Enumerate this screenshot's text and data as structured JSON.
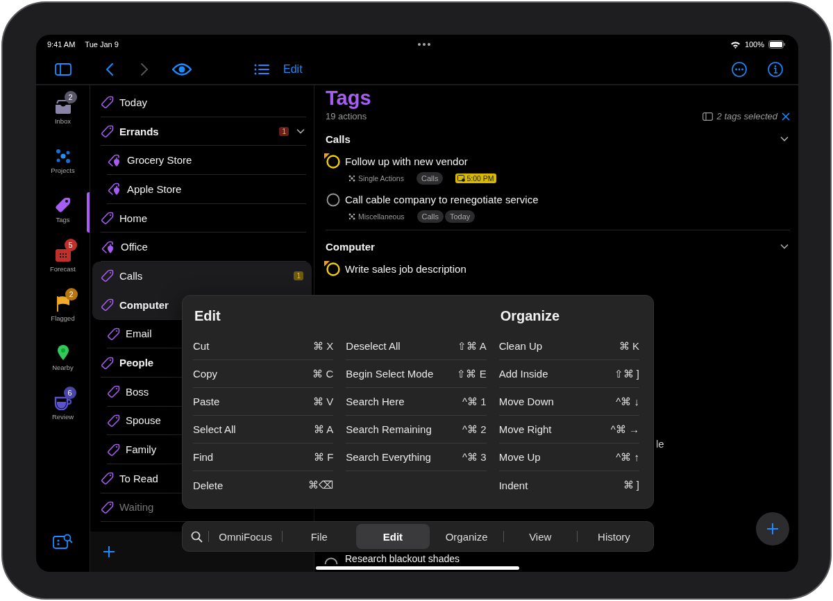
{
  "status_bar": {
    "time": "9:41 AM",
    "date": "Tue Jan 9",
    "battery": "100%"
  },
  "toolbar": {
    "edit_label": "Edit"
  },
  "rail": [
    {
      "kind": "inbox",
      "label": "Inbox",
      "badge": "2",
      "color": "#5a5868",
      "selected": false
    },
    {
      "kind": "projects",
      "label": "Projects",
      "selected": false
    },
    {
      "kind": "tags",
      "label": "Tags",
      "selected": true
    },
    {
      "kind": "forecast",
      "label": "Forecast",
      "badge": "5",
      "color": "#c0302b",
      "selected": false
    },
    {
      "kind": "flagged",
      "label": "Flagged",
      "badge": "2",
      "color": "#b8740f",
      "selected": false
    },
    {
      "kind": "nearby",
      "label": "Nearby",
      "selected": false
    },
    {
      "kind": "review",
      "label": "Review",
      "badge": "6",
      "color": "#4b45a8",
      "selected": false
    }
  ],
  "tags": [
    {
      "name": "Today",
      "kind": "tag",
      "selected": false
    },
    {
      "name": "Errands",
      "kind": "tag",
      "selected": false,
      "badge": "1",
      "color": "#6b1f1c",
      "expanded": true,
      "children": [
        {
          "name": "Grocery Store",
          "kind": "location",
          "selected": false
        },
        {
          "name": "Apple Store",
          "kind": "location",
          "selected": false
        }
      ]
    },
    {
      "name": "Home",
      "kind": "tag",
      "selected": false
    },
    {
      "name": "Office",
      "kind": "location",
      "selected": false
    },
    {
      "name": "Calls",
      "kind": "tag",
      "selected": true,
      "badge": "1",
      "color": "#6b5a10"
    },
    {
      "name": "Computer",
      "kind": "tag",
      "selected": true,
      "children": [
        {
          "name": "Email",
          "kind": "tag",
          "selected": false
        }
      ]
    },
    {
      "name": "People",
      "kind": "tag",
      "selected": false,
      "children": [
        {
          "name": "Boss",
          "kind": "tag",
          "selected": false
        },
        {
          "name": "Spouse",
          "kind": "tag",
          "selected": false
        },
        {
          "name": "Family",
          "kind": "tag",
          "selected": false
        }
      ]
    },
    {
      "name": "To Read",
      "kind": "tag",
      "selected": false
    },
    {
      "name": "Waiting",
      "kind": "tag",
      "selected": false,
      "on_hold": true
    }
  ],
  "main": {
    "title": "Tags",
    "subtitle": "19 actions",
    "selection": "2 tags selected",
    "sections": [
      {
        "title": "Calls",
        "actions": [
          {
            "title": "Follow up with new vendor",
            "flagged": true,
            "project": "Single Actions",
            "tags": [
              "Calls"
            ],
            "due": "5:00 PM"
          },
          {
            "title": "Call cable company to renegotiate service",
            "flagged": false,
            "project": "Miscellaneous",
            "tags": [
              "Calls",
              "Today"
            ]
          }
        ]
      },
      {
        "title": "Computer",
        "actions": [
          {
            "title": "Write sales job description",
            "flagged": true
          }
        ]
      }
    ],
    "partial_texts": [
      "le"
    ],
    "bottom_action": "Research blackout shades"
  },
  "shortcut_menu": {
    "columns": [
      {
        "heading": "Edit",
        "items": [
          {
            "label": "Cut",
            "shortcut": "⌘ X"
          },
          {
            "label": "Copy",
            "shortcut": "⌘ C"
          },
          {
            "label": "Paste",
            "shortcut": "⌘ V"
          },
          {
            "label": "Select All",
            "shortcut": "⌘ A"
          },
          {
            "label": "Find",
            "shortcut": "⌘ F"
          },
          {
            "label": "Delete",
            "shortcut": "⌘⌫"
          }
        ]
      },
      {
        "items": [
          {
            "label": "Deselect All",
            "shortcut": "⇧⌘ A"
          },
          {
            "label": "Begin Select Mode",
            "shortcut": "⇧⌘ E"
          },
          {
            "label": "Search Here",
            "shortcut": "^⌘ 1"
          },
          {
            "label": "Search Remaining",
            "shortcut": "^⌘ 2"
          },
          {
            "label": "Search Everything",
            "shortcut": "^⌘ 3"
          }
        ]
      },
      {
        "heading": "Organize",
        "items": [
          {
            "label": "Clean Up",
            "shortcut": "⌘ K"
          },
          {
            "label": "Add Inside",
            "shortcut": "⇧⌘ ]"
          },
          {
            "label": "Move Down",
            "shortcut": "^⌘ ↓"
          },
          {
            "label": "Move Right",
            "shortcut": "^⌘ →"
          },
          {
            "label": "Move Up",
            "shortcut": "^⌘ ↑"
          },
          {
            "label": "Indent",
            "shortcut": "⌘ ]"
          }
        ]
      }
    ]
  },
  "menu_bar": [
    {
      "label": "OmniFocus",
      "selected": false
    },
    {
      "label": "File",
      "selected": false
    },
    {
      "label": "Edit",
      "selected": true
    },
    {
      "label": "Organize",
      "selected": false
    },
    {
      "label": "View",
      "selected": false
    },
    {
      "label": "History",
      "selected": false
    }
  ]
}
